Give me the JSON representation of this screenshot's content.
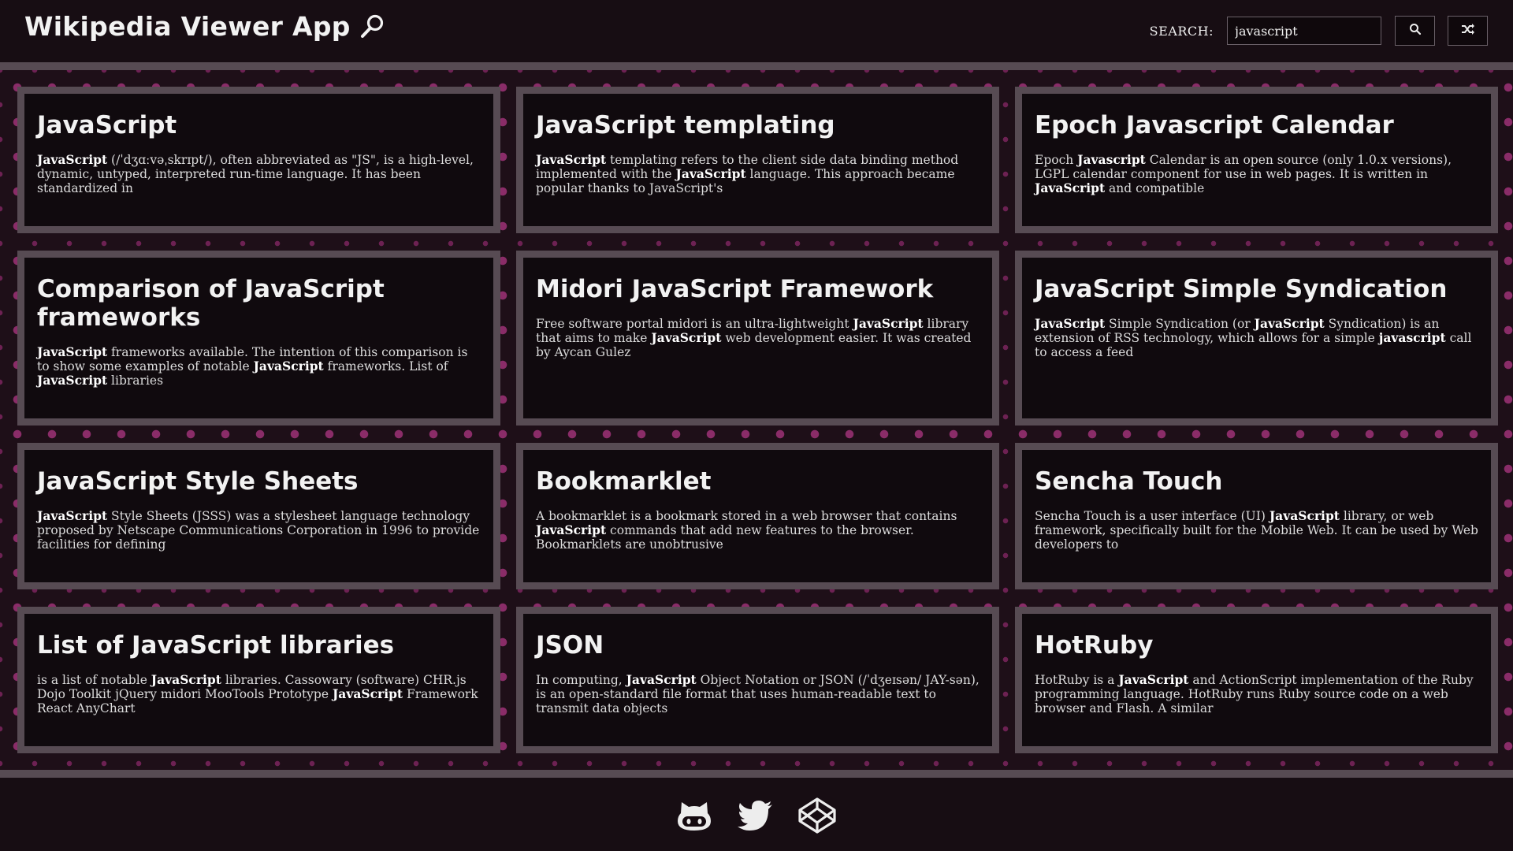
{
  "header": {
    "title": "Wikipedia Viewer App",
    "title_icon": "magnifier-icon",
    "search_label": "SEARCH:",
    "search_value": "javascript",
    "search_button_icon": "search-icon",
    "random_button_icon": "shuffle-icon"
  },
  "results": [
    {
      "title": "JavaScript",
      "parts": [
        {
          "b": "JavaScript"
        },
        {
          "t": " (/ˈdʒɑːvəˌskrɪpt/), often abbreviated as \"JS\", is a high-level, dynamic, untyped, interpreted run-time language. It has been standardized in"
        }
      ]
    },
    {
      "title": "JavaScript templating",
      "parts": [
        {
          "b": "JavaScript"
        },
        {
          "t": " templating refers to the client side data binding method implemented with the "
        },
        {
          "b": "JavaScript"
        },
        {
          "t": " language. This approach became popular thanks to JavaScript's"
        }
      ]
    },
    {
      "title": "Epoch Javascript Calendar",
      "parts": [
        {
          "t": "Epoch "
        },
        {
          "b": "Javascript"
        },
        {
          "t": " Calendar is an open source (only 1.0.x versions), LGPL calendar component for use in web pages. It is written in "
        },
        {
          "b": "JavaScript"
        },
        {
          "t": " and compatible"
        }
      ]
    },
    {
      "title": "Comparison of JavaScript frameworks",
      "parts": [
        {
          "b": "JavaScript"
        },
        {
          "t": " frameworks available. The intention of this comparison is to show some examples of notable "
        },
        {
          "b": "JavaScript"
        },
        {
          "t": " frameworks. List of "
        },
        {
          "b": "JavaScript"
        },
        {
          "t": " libraries"
        }
      ]
    },
    {
      "title": "Midori JavaScript Framework",
      "parts": [
        {
          "t": "Free software portal midori is an ultra-lightweight "
        },
        {
          "b": "JavaScript"
        },
        {
          "t": " library that aims to make "
        },
        {
          "b": "JavaScript"
        },
        {
          "t": " web development easier. It was created by Aycan Gulez"
        }
      ]
    },
    {
      "title": "JavaScript Simple Syndication",
      "parts": [
        {
          "b": "JavaScript"
        },
        {
          "t": " Simple Syndication (or "
        },
        {
          "b": "JavaScript"
        },
        {
          "t": " Syndication) is an extension of RSS technology, which allows for a simple "
        },
        {
          "b": "javascript"
        },
        {
          "t": " call to access a feed"
        }
      ]
    },
    {
      "title": "JavaScript Style Sheets",
      "parts": [
        {
          "b": "JavaScript"
        },
        {
          "t": " Style Sheets (JSSS) was a stylesheet language technology proposed by Netscape Communications Corporation in 1996 to provide facilities for defining"
        }
      ]
    },
    {
      "title": "Bookmarklet",
      "parts": [
        {
          "t": "A bookmarklet is a bookmark stored in a web browser that contains "
        },
        {
          "b": "JavaScript"
        },
        {
          "t": " commands that add new features to the browser. Bookmarklets are unobtrusive"
        }
      ]
    },
    {
      "title": "Sencha Touch",
      "parts": [
        {
          "t": "Sencha Touch is a user interface (UI) "
        },
        {
          "b": "JavaScript"
        },
        {
          "t": " library, or web framework, specifically built for the Mobile Web. It can be used by Web developers to"
        }
      ]
    },
    {
      "title": "List of JavaScript libraries",
      "parts": [
        {
          "t": "is a list of notable "
        },
        {
          "b": "JavaScript"
        },
        {
          "t": " libraries. Cassowary (software) CHR.js Dojo Toolkit jQuery midori MooTools Prototype "
        },
        {
          "b": "JavaScript"
        },
        {
          "t": " Framework React AnyChart"
        }
      ]
    },
    {
      "title": "JSON",
      "parts": [
        {
          "t": "In computing, "
        },
        {
          "b": "JavaScript"
        },
        {
          "t": " Object Notation or JSON (/ˈdʒeɪsən/ JAY-sən), is an open-standard file format that uses human-readable text to transmit data objects"
        }
      ]
    },
    {
      "title": "HotRuby",
      "parts": [
        {
          "t": "HotRuby is a "
        },
        {
          "b": "JavaScript"
        },
        {
          "t": " and ActionScript implementation of the Ruby programming language. HotRuby runs Ruby source code on a web browser and Flash. A similar"
        }
      ]
    }
  ],
  "footer": {
    "links": [
      {
        "icon": "github-icon"
      },
      {
        "icon": "twitter-icon"
      },
      {
        "icon": "codepen-icon"
      }
    ]
  },
  "colors": {
    "background": "#1e0f18",
    "dots": "#8a2c68",
    "card_border": "#574b53",
    "card_background": "#100a0e",
    "text": "#f2f2f2"
  }
}
